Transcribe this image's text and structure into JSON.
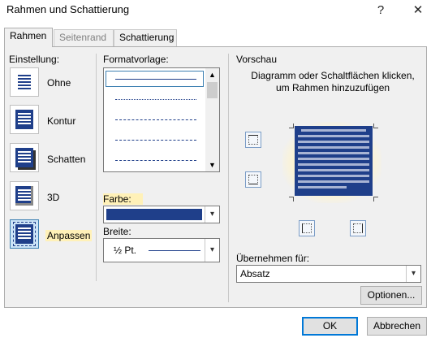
{
  "dialog": {
    "title": "Rahmen und Schattierung",
    "help_glyph": "?",
    "close_glyph": "✕"
  },
  "tabs": [
    {
      "label": "Rahmen",
      "active": true
    },
    {
      "label": "Seitenrand",
      "active": false
    },
    {
      "label": "Schattierung",
      "active": false
    }
  ],
  "settings": {
    "header": "Einstellung:",
    "items": [
      {
        "label": "Ohne",
        "icon": "setting-none-icon"
      },
      {
        "label": "Kontur",
        "icon": "setting-box-icon"
      },
      {
        "label": "Schatten",
        "icon": "setting-shadow-icon"
      },
      {
        "label": "3D",
        "icon": "setting-3d-icon"
      },
      {
        "label": "Anpassen",
        "icon": "setting-custom-icon",
        "selected": true
      }
    ]
  },
  "style": {
    "header": "Formatvorlage:",
    "options": [
      "solid",
      "dotted",
      "dash-small",
      "dash-large",
      "dash-dot"
    ],
    "selected": "solid"
  },
  "color": {
    "label": "Farbe:",
    "value": "#1f3f8a"
  },
  "width": {
    "label": "Breite:",
    "value": "½ Pt."
  },
  "preview": {
    "header": "Vorschau",
    "instruction": "Diagramm oder Schaltflächen klicken, um Rahmen hinzuzufügen",
    "apply_label": "Übernehmen für:",
    "apply_value": "Absatz",
    "options_button": "Optionen..."
  },
  "footer": {
    "ok": "OK",
    "cancel": "Abbrechen"
  },
  "colors": {
    "accent": "#1f3f8a",
    "highlight": "#fff1b8",
    "selection": "#cce4f7"
  }
}
